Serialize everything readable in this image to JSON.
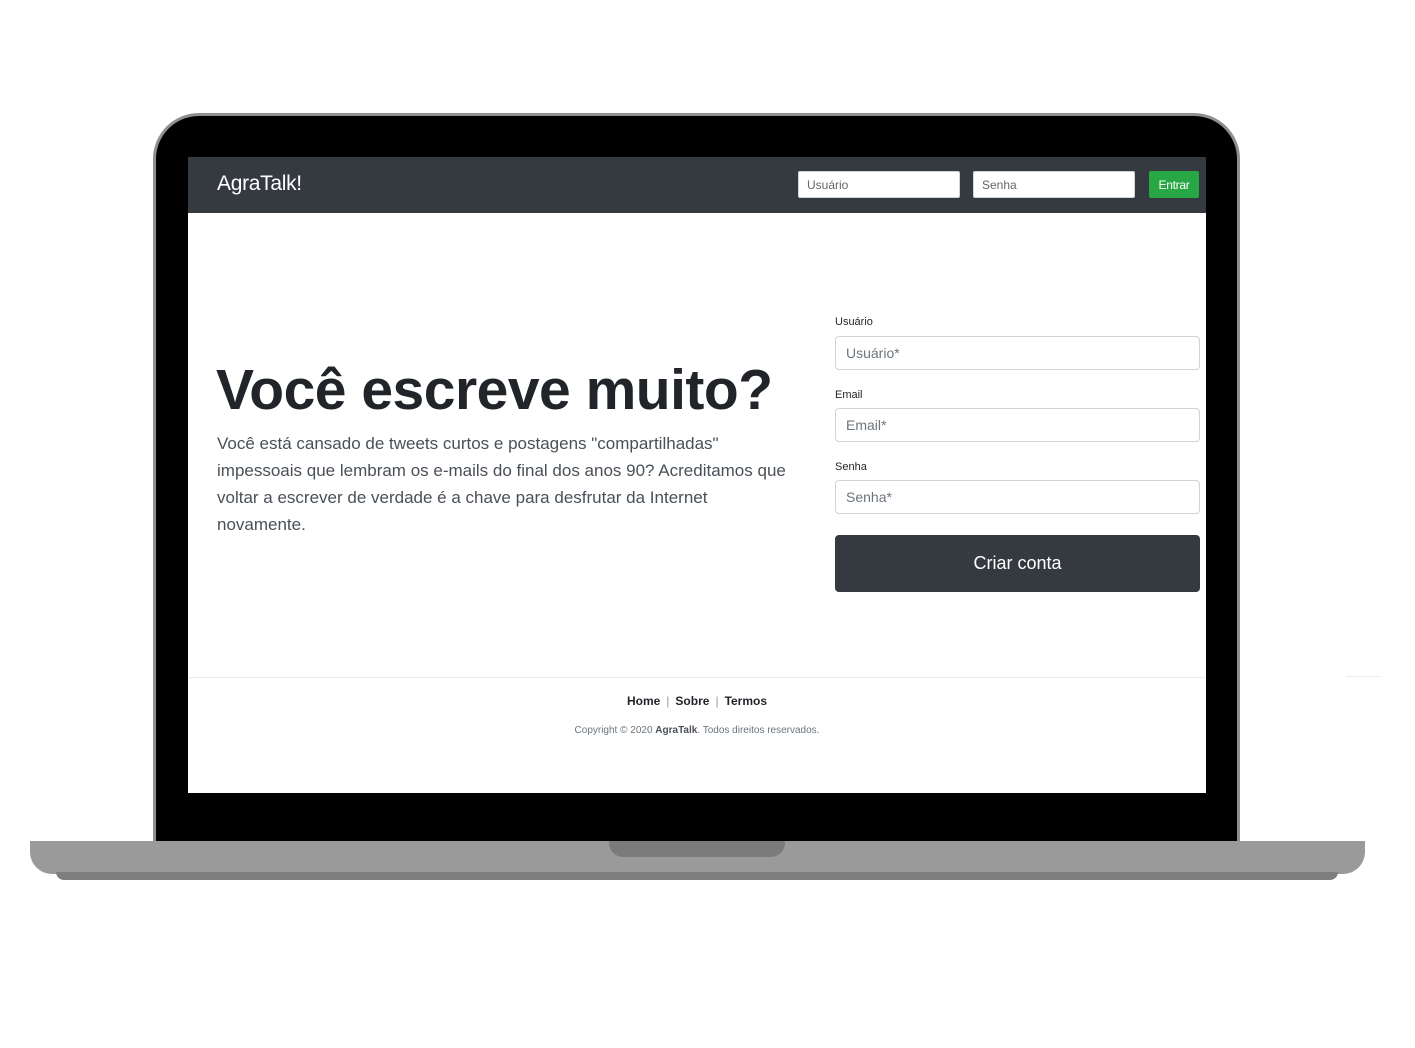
{
  "navbar": {
    "brand": "AgraTalk!",
    "username_placeholder": "Usuário",
    "password_placeholder": "Senha",
    "login_button": "Entrar"
  },
  "hero": {
    "headline": "Você escreve muito?",
    "lead": "Você está cansado de tweets curtos e postagens \"compartilhadas\" impessoais que lembram os e-mails do final dos anos 90? Acreditamos que voltar a escrever de verdade é a chave para desfrutar da Internet novamente."
  },
  "signup": {
    "username_label": "Usuário",
    "username_placeholder": "Usuário*",
    "email_label": "Email",
    "email_placeholder": "Email*",
    "password_label": "Senha",
    "password_placeholder": "Senha*",
    "submit": "Criar conta"
  },
  "footer": {
    "links": [
      "Home",
      "Sobre",
      "Termos"
    ],
    "copyright_prefix": "Copyright © 2020",
    "copyright_brand": "AgraTalk",
    "copyright_suffix": ". Todos direitos reservados."
  },
  "colors": {
    "navbar": "#343a40",
    "login_button": "#28a745",
    "submit_button": "#343a40"
  }
}
